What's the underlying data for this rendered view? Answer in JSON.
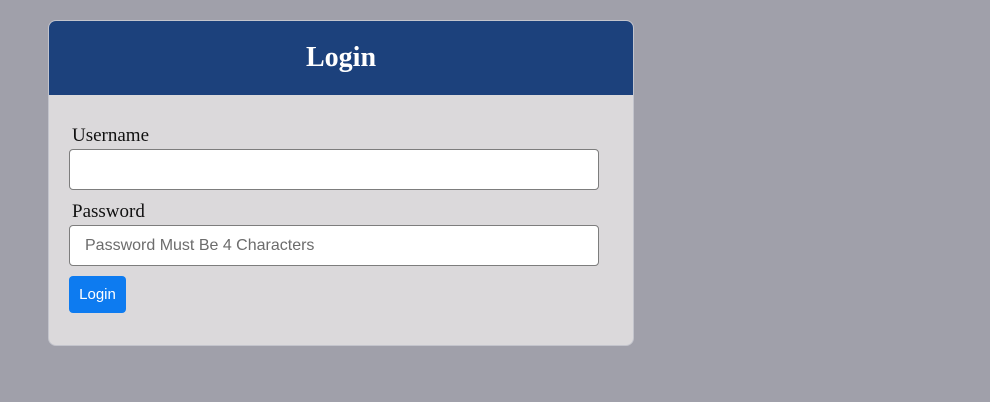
{
  "login_card": {
    "title": "Login",
    "username": {
      "label": "Username",
      "value": "",
      "placeholder": ""
    },
    "password": {
      "label": "Password",
      "value": "",
      "placeholder": "Password Must Be 4 Characters"
    },
    "submit_label": "Login"
  },
  "colors": {
    "page_background": "#a0a0aa",
    "card_background": "#dbd9db",
    "header_background": "#1c417c",
    "button_background": "#0d7bf0"
  }
}
